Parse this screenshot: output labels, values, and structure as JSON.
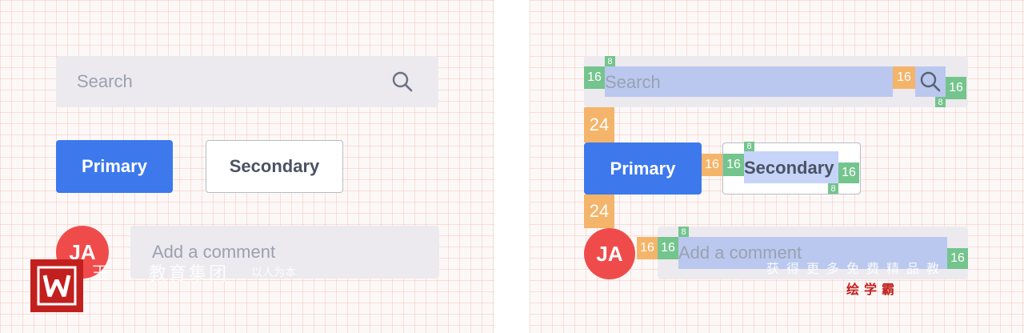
{
  "search": {
    "placeholder": "Search",
    "icon": "search-icon"
  },
  "buttons": {
    "primary_label": "Primary",
    "secondary_label": "Secondary"
  },
  "comment": {
    "avatar_initials": "JA",
    "placeholder": "Add a comment"
  },
  "spacing": {
    "s8": "8",
    "s16": "16",
    "s24": "24"
  },
  "watermark_left": {
    "brand": "王",
    "title": "教育集团",
    "slogan": "以人为本"
  },
  "watermark_right": {
    "line1": "获得更多免费精品教",
    "brand": "绘学霸"
  },
  "colors": {
    "primary": "#3d78ec",
    "avatar": "#f04b4b",
    "spacing_green": "#74c48d",
    "spacing_orange": "#f4b46a",
    "highlight_blue": "#7ea0f0",
    "logo_red": "#c2201e"
  }
}
